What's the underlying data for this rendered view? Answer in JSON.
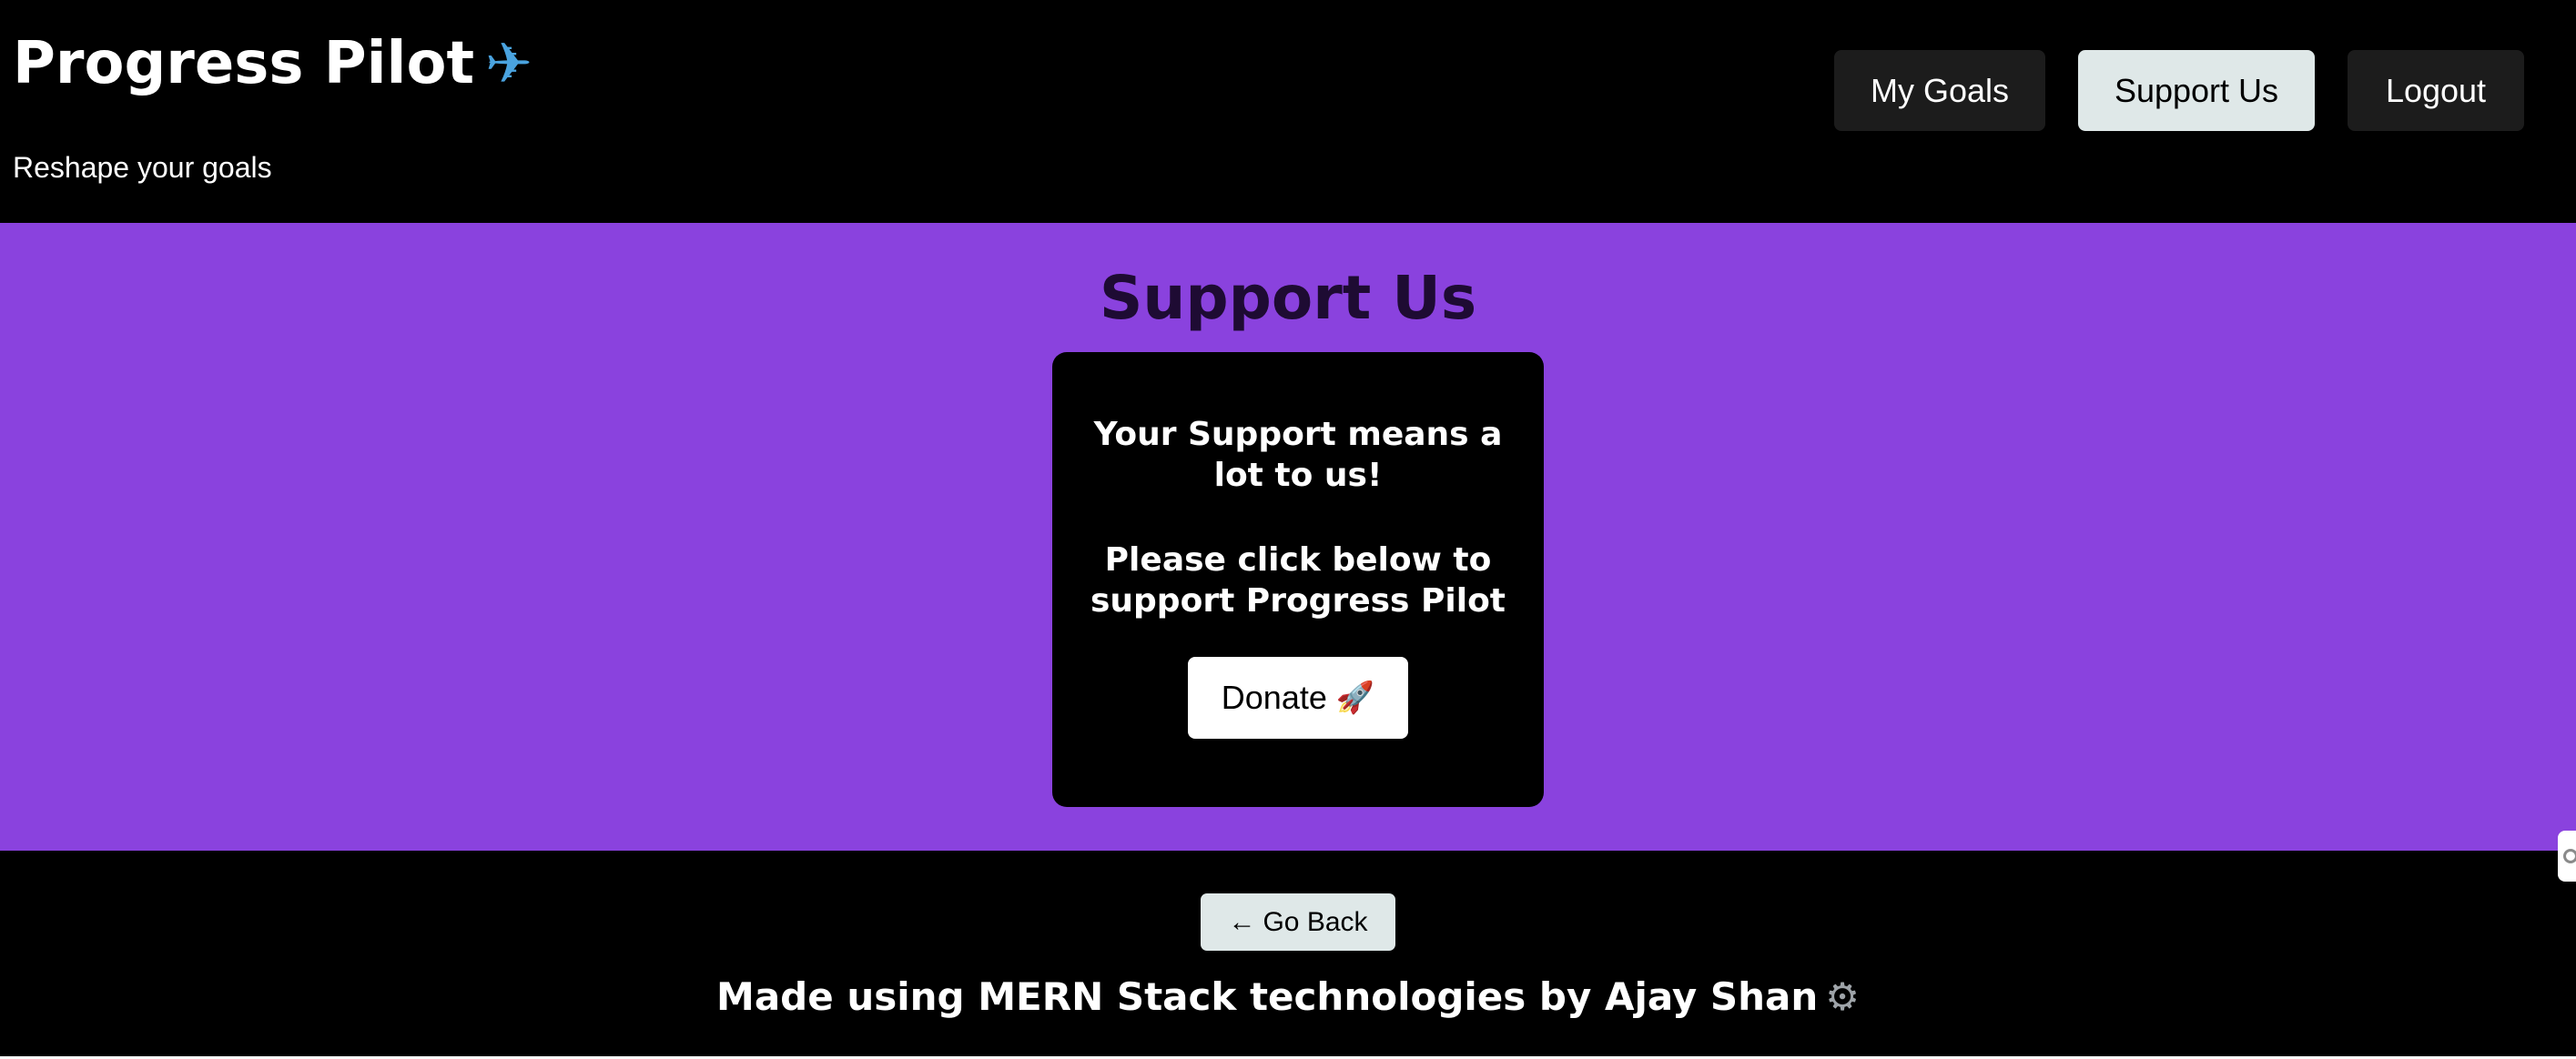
{
  "header": {
    "title": "Progress Pilot",
    "title_icon": "airplane-icon",
    "subtitle": "Reshape your goals",
    "nav": {
      "my_goals": "My Goals",
      "support_us": "Support Us",
      "logout": "Logout"
    }
  },
  "main": {
    "heading": "Support Us",
    "card": {
      "line1": "Your Support means a lot to us!",
      "line2": "Please click below to support Progress Pilot",
      "donate_label": "Donate",
      "donate_icon": "rocket-icon"
    }
  },
  "footer": {
    "go_back_arrow": "←",
    "go_back_label": "Go Back",
    "credit": "Made using MERN Stack technologies by Ajay Shan",
    "credit_icon": "gear-icon"
  },
  "colors": {
    "header_bg": "#000000",
    "main_bg": "#8a42de",
    "heading_text": "#1e0b33",
    "active_nav_bg": "#dfe8e8",
    "nav_bg": "#1c1c1c"
  }
}
